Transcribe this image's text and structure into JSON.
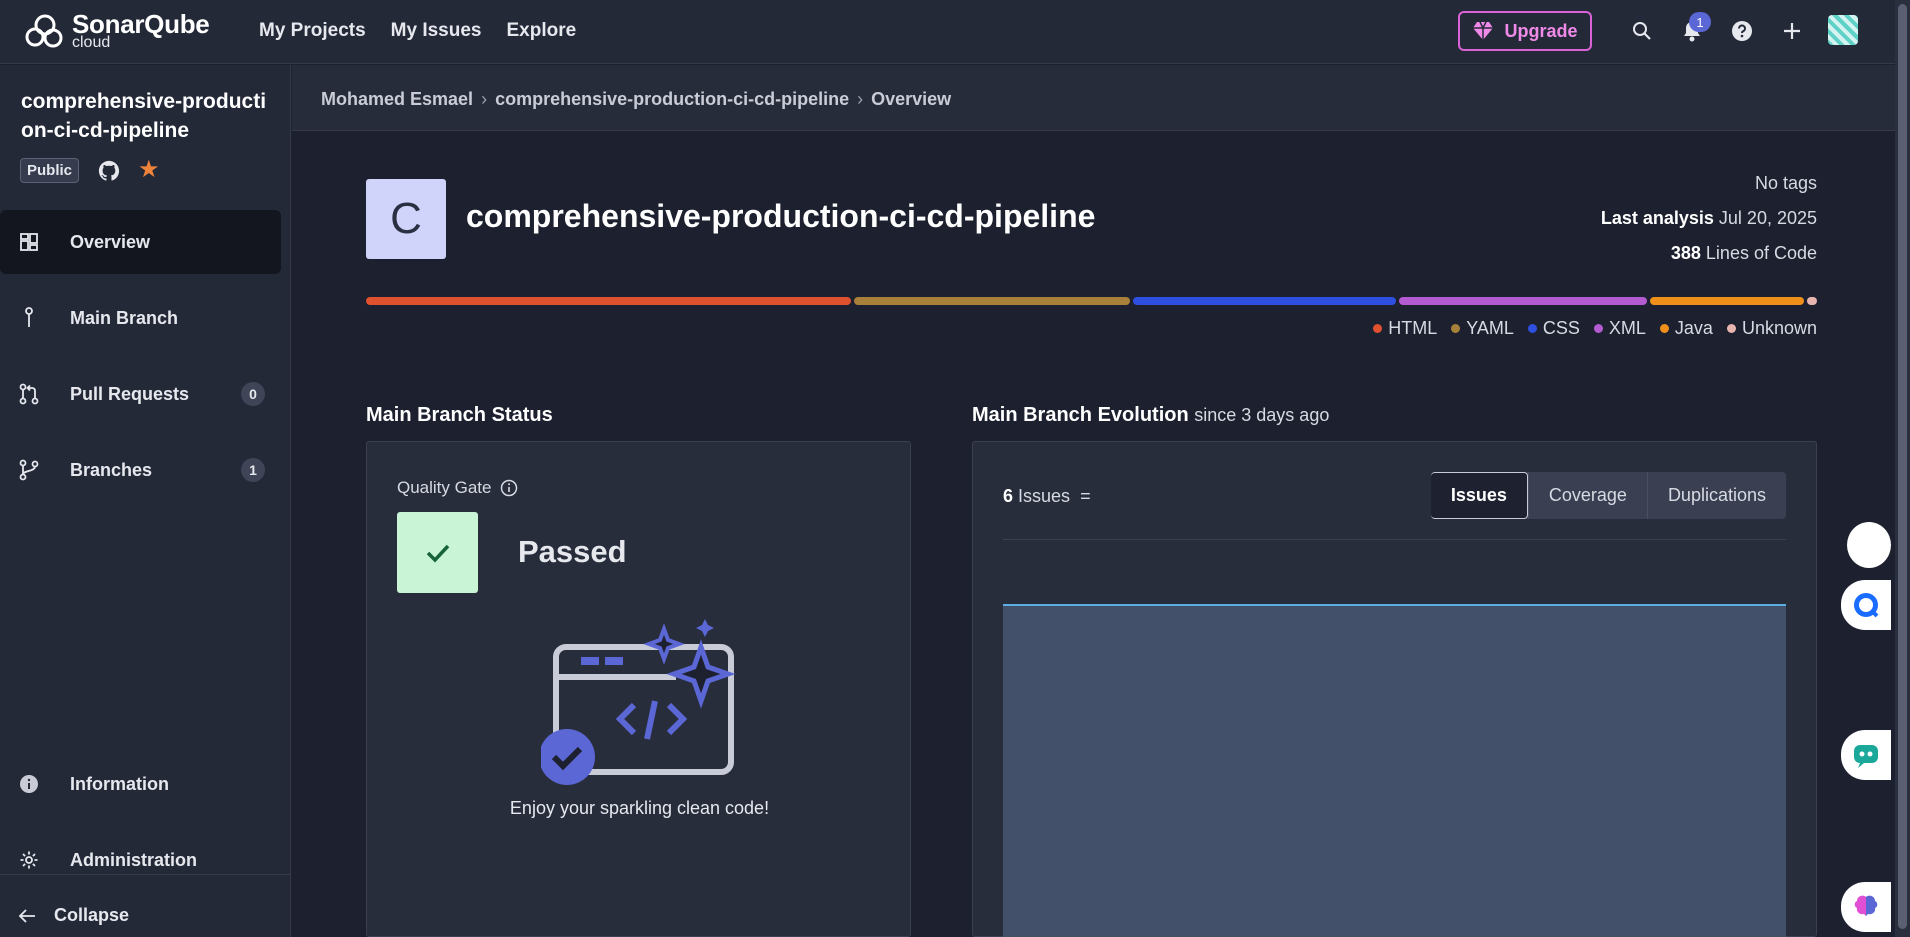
{
  "brand": {
    "name": "SonarQube",
    "product": "cloud"
  },
  "topnav": {
    "links": [
      "My Projects",
      "My Issues",
      "Explore"
    ],
    "upgrade_label": "Upgrade",
    "notification_count": "1"
  },
  "sidebar": {
    "project_name": "comprehensive-production-ci-cd-pipeline",
    "visibility": "Public",
    "items": [
      {
        "label": "Overview"
      },
      {
        "label": "Main Branch"
      },
      {
        "label": "Pull Requests",
        "count": "0"
      },
      {
        "label": "Branches",
        "count": "1"
      },
      {
        "label": "Information"
      },
      {
        "label": "Administration"
      }
    ],
    "collapse_label": "Collapse"
  },
  "breadcrumb": [
    "Mohamed Esmael",
    "comprehensive-production-ci-cd-pipeline",
    "Overview"
  ],
  "project": {
    "avatar_letter": "C",
    "title": "comprehensive-production-ci-cd-pipeline",
    "tags": "No tags",
    "last_analysis_label": "Last analysis",
    "last_analysis_value": "Jul 20, 2025",
    "loc_value": "388",
    "loc_label": "Lines of Code"
  },
  "languages": [
    {
      "name": "HTML",
      "color": "#e0512f",
      "share": 33.7
    },
    {
      "name": "YAML",
      "color": "#a8803a",
      "share": 19.2
    },
    {
      "name": "CSS",
      "color": "#2f4fe0",
      "share": 18.3
    },
    {
      "name": "XML",
      "color": "#b45bd2",
      "share": 17.2
    },
    {
      "name": "Java",
      "color": "#f0901a",
      "share": 10.7
    },
    {
      "name": "Unknown",
      "color": "#e8b4b0",
      "share": 0.7
    }
  ],
  "status": {
    "title": "Main Branch Status",
    "qg_label": "Quality Gate",
    "qg_status": "Passed",
    "clean_msg": "Enjoy your sparkling clean code!"
  },
  "evolution": {
    "title": "Main Branch Evolution",
    "since": "since 3 days ago",
    "issues_count": "6",
    "issues_label": "Issues",
    "trend": "=",
    "tabs": [
      "Issues",
      "Coverage",
      "Duplications"
    ],
    "active_tab": "Issues"
  }
}
